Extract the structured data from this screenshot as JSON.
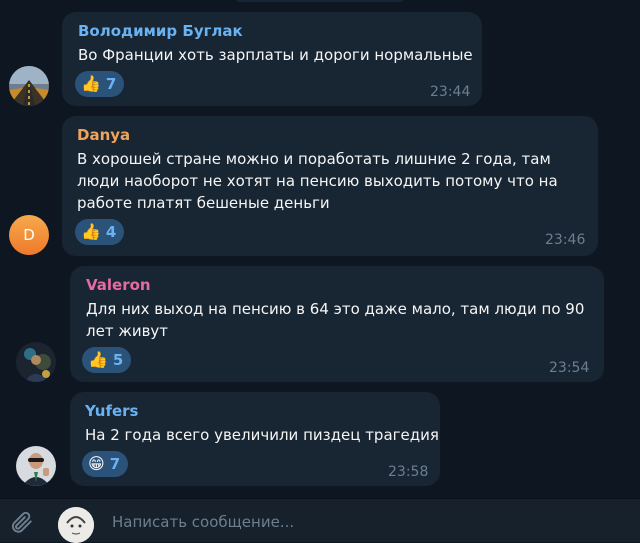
{
  "messages": [
    {
      "author": "Володимир Буглак",
      "author_color": "#6ab2f2",
      "lines": [
        "Во Франции хоть зарплаты и дороги нормальные"
      ],
      "reaction": {
        "emoji": "👍",
        "icon": "thumbs-up",
        "count": "7"
      },
      "time": "23:44",
      "avatar": "road-photo"
    },
    {
      "author": "Danya",
      "author_color": "#f0a35a",
      "lines": [
        "В хорошей стране можно и поработать лишние 2 года, там",
        "люди наоборот не хотят на пенсию выходить потому что на",
        "работе платят бешеные деньги"
      ],
      "reaction": {
        "emoji": "👍",
        "icon": "thumbs-up",
        "count": "4"
      },
      "time": "23:46",
      "avatar_letter": "D"
    },
    {
      "author": "Valeron",
      "author_color": "#e76aa1",
      "lines": [
        "Для них выход на пенсию в 64 это даже мало, там люди по 90",
        "лет живут"
      ],
      "reaction": {
        "emoji": "👍",
        "icon": "thumbs-up",
        "count": "5"
      },
      "time": "23:54",
      "avatar": "photo"
    },
    {
      "author": "Yufers",
      "author_color": "#6ab2f2",
      "lines": [
        "На 2 года всего увеличили пиздец трагедия"
      ],
      "reaction": {
        "emoji": "😁",
        "icon": "grinning-face",
        "count": "7"
      },
      "time": "23:58",
      "avatar": "photo"
    }
  ],
  "composer": {
    "placeholder": "Написать сообщение..."
  },
  "colors": {
    "background": "#0e1621",
    "bubble": "#182533",
    "reaction_bg": "#2b5278",
    "reaction_text": "#6ab2f2",
    "time": "#6d7f8f"
  }
}
